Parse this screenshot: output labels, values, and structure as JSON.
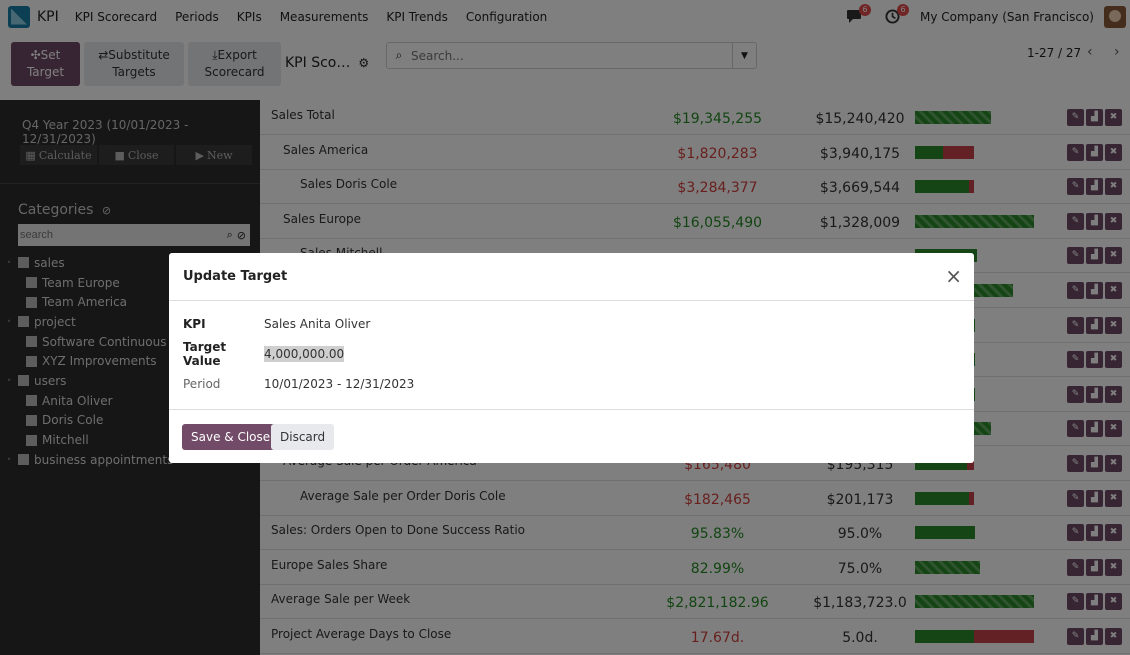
{
  "navbar": {
    "app_name": "KPI",
    "menu": [
      "KPI Scorecard",
      "Periods",
      "KPIs",
      "Measurements",
      "KPI Trends",
      "Configuration"
    ],
    "messages_count": "6",
    "activities_count": "6",
    "company": "My Company (San Francisco)"
  },
  "control": {
    "set_target": [
      "Set",
      "Target"
    ],
    "substitute_targets": [
      "Substitute",
      "Targets"
    ],
    "export_scorecard": [
      "Export",
      "Scorecard"
    ],
    "breadcrumb": "KPI Sco…",
    "search_placeholder": "Search...",
    "pager": "1-27 / 27"
  },
  "sidebar": {
    "period": "Q4 Year 2023 (10/01/2023 - 12/31/2023)",
    "calculate": "Calculate",
    "close": "Close",
    "new": "New",
    "categories_title": "Categories",
    "search_placeholder": "search",
    "tree": [
      {
        "label": "sales",
        "level": 0
      },
      {
        "label": "Team Europe",
        "level": 1
      },
      {
        "label": "Team America",
        "level": 1
      },
      {
        "label": "project",
        "level": 0
      },
      {
        "label": "Software Continuous",
        "level": 1
      },
      {
        "label": "XYZ Improvements",
        "level": 1
      },
      {
        "label": "users",
        "level": 0
      },
      {
        "label": "Anita Oliver",
        "level": 1
      },
      {
        "label": "Doris Cole",
        "level": 1
      },
      {
        "label": "Mitchell",
        "level": 1
      },
      {
        "label": "business appointments",
        "level": 0
      }
    ]
  },
  "rows": [
    {
      "name": "Sales Total",
      "indent": 0,
      "value": "$19,345,255",
      "value_color": "green",
      "target": "$15,240,420",
      "bar": [
        [
          76,
          "s"
        ]
      ]
    },
    {
      "name": "Sales America",
      "indent": 1,
      "value": "$1,820,283",
      "value_color": "red",
      "target": "$3,940,175",
      "bar": [
        [
          28,
          "g"
        ],
        [
          31,
          "r"
        ]
      ]
    },
    {
      "name": "Sales Doris Cole",
      "indent": 2,
      "value": "$3,284,377",
      "value_color": "red",
      "target": "$3,669,544",
      "bar": [
        [
          54,
          "g"
        ],
        [
          5,
          "r"
        ]
      ]
    },
    {
      "name": "Sales Europe",
      "indent": 1,
      "value": "$16,055,490",
      "value_color": "green",
      "target": "$1,328,009",
      "bar": [
        [
          119,
          "s"
        ]
      ]
    },
    {
      "name": "Sales Mitchell",
      "indent": 2,
      "value": "",
      "value_color": "green",
      "target": "",
      "bar": [
        [
          62,
          "g"
        ]
      ]
    },
    {
      "name": "",
      "indent": 0,
      "value": "",
      "value_color": "green",
      "target": "",
      "bar": [
        [
          98,
          "s"
        ]
      ]
    },
    {
      "name": "",
      "indent": 0,
      "value": "",
      "value_color": "green",
      "target": "",
      "bar": [
        [
          60,
          "g"
        ]
      ]
    },
    {
      "name": "",
      "indent": 0,
      "value": "",
      "value_color": "green",
      "target": "",
      "bar": [
        [
          60,
          "g"
        ]
      ]
    },
    {
      "name": "",
      "indent": 0,
      "value": "",
      "value_color": "green",
      "target": "",
      "bar": [
        [
          60,
          "g"
        ]
      ]
    },
    {
      "name": "",
      "indent": 0,
      "value": "",
      "value_color": "green",
      "target": "",
      "bar": [
        [
          76,
          "s"
        ]
      ]
    },
    {
      "name": "Average Sale per Order America",
      "indent": 1,
      "value": "$165,480",
      "value_color": "red",
      "target": "$195,315",
      "bar": [
        [
          52,
          "g"
        ],
        [
          7,
          "r"
        ]
      ]
    },
    {
      "name": "Average Sale per Order Doris Cole",
      "indent": 2,
      "value": "$182,465",
      "value_color": "red",
      "target": "$201,173",
      "bar": [
        [
          54,
          "g"
        ],
        [
          5,
          "r"
        ]
      ]
    },
    {
      "name": "Sales: Orders Open to Done Success Ratio",
      "indent": 0,
      "value": "95.83%",
      "value_color": "green",
      "target": "95.0%",
      "bar": [
        [
          60,
          "g"
        ]
      ]
    },
    {
      "name": "Europe Sales Share",
      "indent": 0,
      "value": "82.99%",
      "value_color": "green",
      "target": "75.0%",
      "bar": [
        [
          65,
          "s"
        ]
      ]
    },
    {
      "name": "Average Sale per Week",
      "indent": 0,
      "value": "$2,821,182.96",
      "value_color": "green",
      "target": "$1,183,723.0",
      "bar": [
        [
          119,
          "s"
        ]
      ]
    },
    {
      "name": "Project Average Days to Close",
      "indent": 0,
      "value": "17.67d.",
      "value_color": "red",
      "target": "5.0d.",
      "bar": [
        [
          59,
          "g"
        ],
        [
          60,
          "r"
        ]
      ]
    }
  ],
  "modal": {
    "title": "Update Target",
    "kpi_label": "KPI",
    "kpi_value": "Sales Anita Oliver",
    "target_label": "Target Value",
    "target_value": "4,000,000.00",
    "period_label": "Period",
    "period_value": "10/01/2023 - 12/31/2023",
    "save": "Save & Close",
    "discard": "Discard"
  },
  "colors": {
    "brand": "#714b67",
    "good": "#248a24",
    "bad": "#d0403c"
  }
}
